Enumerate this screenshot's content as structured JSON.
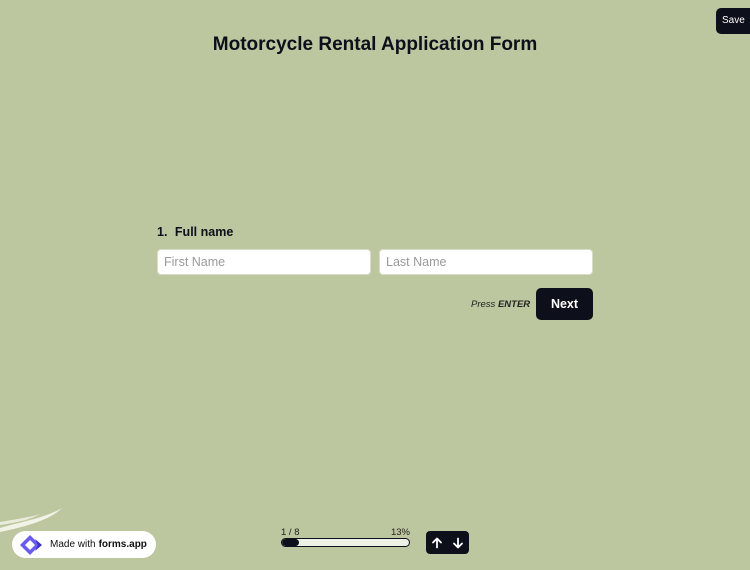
{
  "save_button": "Save",
  "form": {
    "title": "Motorcycle Rental Application Form",
    "question_number": "1.",
    "question_label": "Full name",
    "first_name_placeholder": "First Name",
    "last_name_placeholder": "Last Name",
    "press_prefix": "Press",
    "press_key": "ENTER",
    "next_label": "Next"
  },
  "progress": {
    "counter": "1 / 8",
    "percent_label": "13%",
    "fraction": 0.13
  },
  "navigation": {
    "up_icon": "arrow-up-icon",
    "down_icon": "arrow-down-icon"
  },
  "badge": {
    "prefix": "Made with",
    "brand": "forms.app"
  },
  "colors": {
    "background": "#bcc69f",
    "dark": "#0d0f1a",
    "logo_purple": "#6b5cf0"
  }
}
